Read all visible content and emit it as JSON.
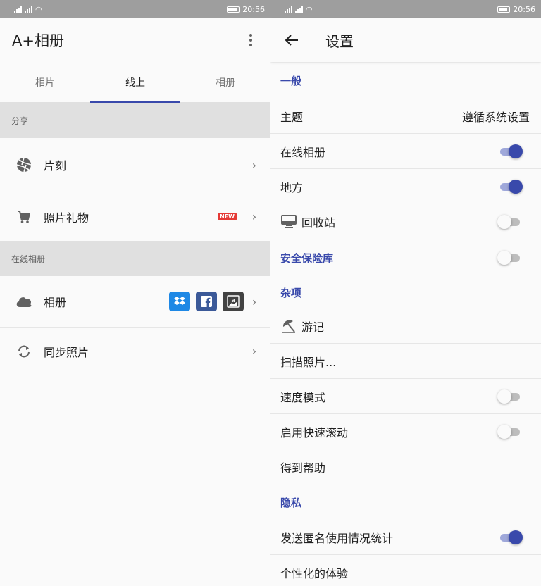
{
  "status": {
    "time": "20:56"
  },
  "left": {
    "app_title": "A+相册",
    "tabs": [
      "相片",
      "线上",
      "相册"
    ],
    "sections": [
      {
        "header": "分享",
        "items": [
          "片刻",
          "照片礼物"
        ]
      },
      {
        "header": "在线相册",
        "items": [
          "相册",
          "同步照片"
        ]
      }
    ],
    "new_badge": "NEW",
    "amazon_letter": "a"
  },
  "right": {
    "title": "设置",
    "categories": {
      "general": "一般",
      "vault": "安全保险库",
      "misc": "杂项",
      "privacy": "隐私"
    },
    "theme": {
      "label": "主题",
      "value": "遵循系统设置"
    },
    "online_album": {
      "label": "在线相册",
      "on": true
    },
    "places": {
      "label": "地方",
      "on": true
    },
    "recycle": {
      "label": "回收站",
      "on": false
    },
    "vault_toggle": {
      "on": false
    },
    "travel": {
      "label": "游记"
    },
    "scan": {
      "label": "扫描照片..."
    },
    "speed_mode": {
      "label": "速度模式",
      "on": false
    },
    "fast_scroll": {
      "label": "启用快速滚动",
      "on": false
    },
    "help": {
      "label": "得到帮助"
    },
    "anon_stats": {
      "label": "发送匿名使用情况统计",
      "on": true
    },
    "personalized": {
      "label": "个性化的体验"
    }
  },
  "colors": {
    "accent": "#3949ab",
    "accent_track": "#9fa8da"
  }
}
